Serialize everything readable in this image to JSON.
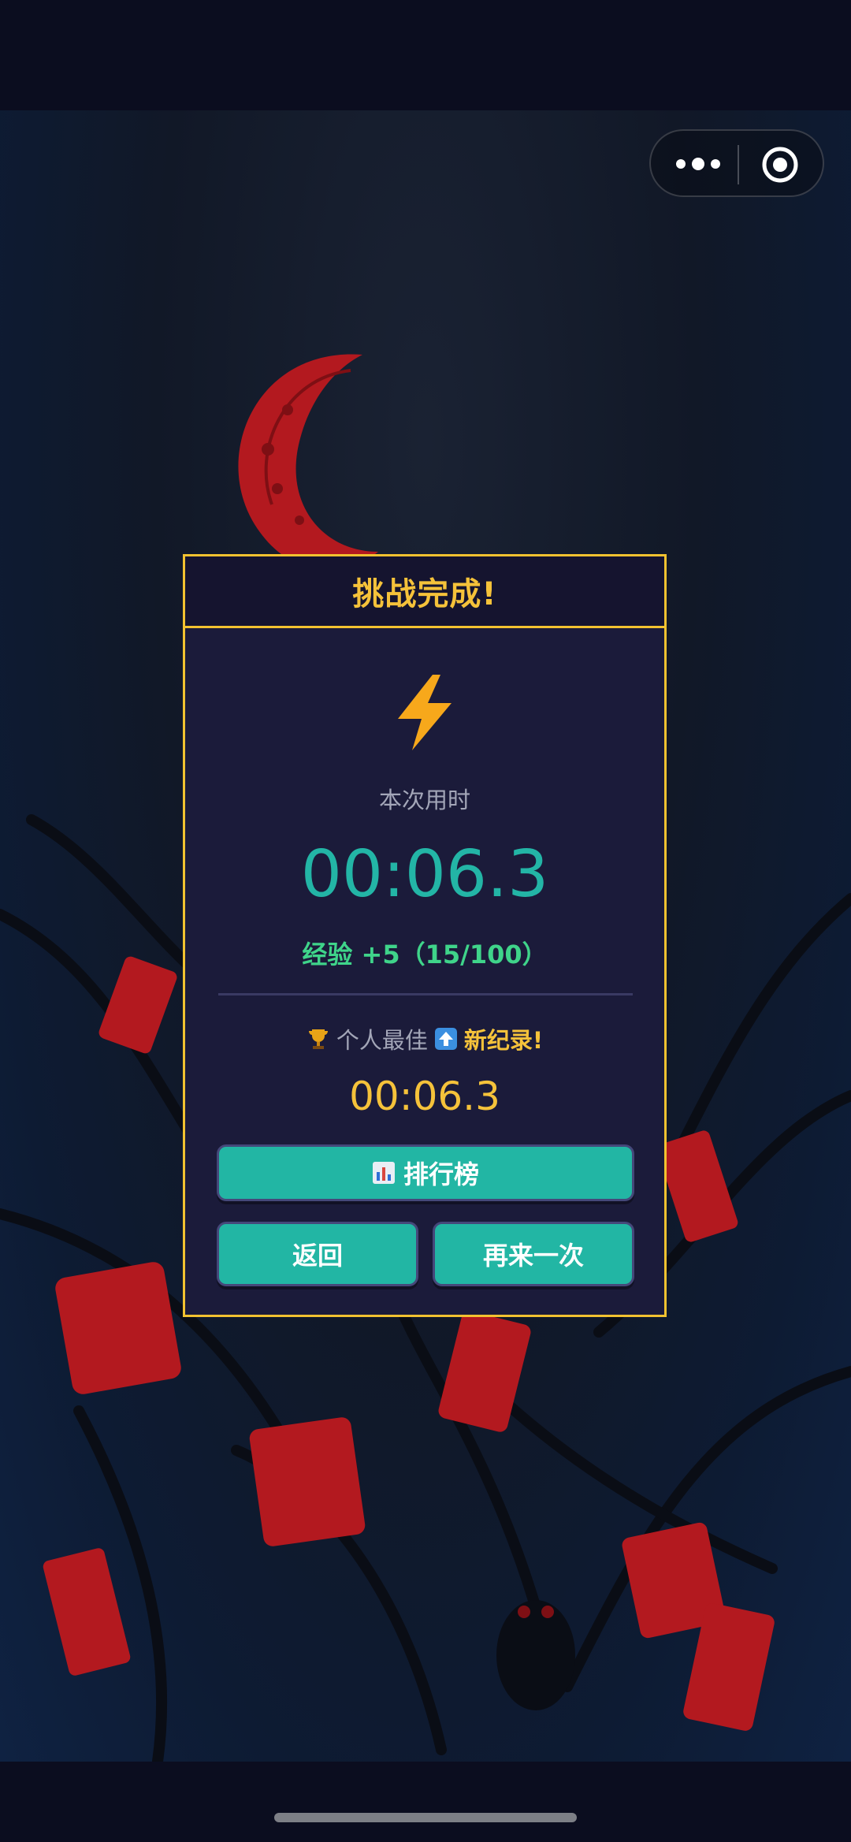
{
  "dialog": {
    "title": "挑战完成!",
    "time_label": "本次用时",
    "time_value": "00:06.3",
    "exp_text": "经验 +5（15/100）",
    "best_label": "个人最佳",
    "new_record": "新纪录!",
    "best_value": "00:06.3",
    "buttons": {
      "leaderboard": "排行榜",
      "back": "返回",
      "again": "再来一次"
    }
  },
  "colors": {
    "accent_gold": "#f2c230",
    "teal": "#22b6a4",
    "exp_green": "#3fd48a",
    "dialog_bg": "#1b1b3a"
  },
  "icons": {
    "header": "lightning-bolt-icon",
    "best": "trophy-icon",
    "record": "up-arrow-icon",
    "leaderboard": "bar-chart-icon",
    "capsule_more": "more-dots-icon",
    "capsule_close": "target-circle-icon"
  }
}
